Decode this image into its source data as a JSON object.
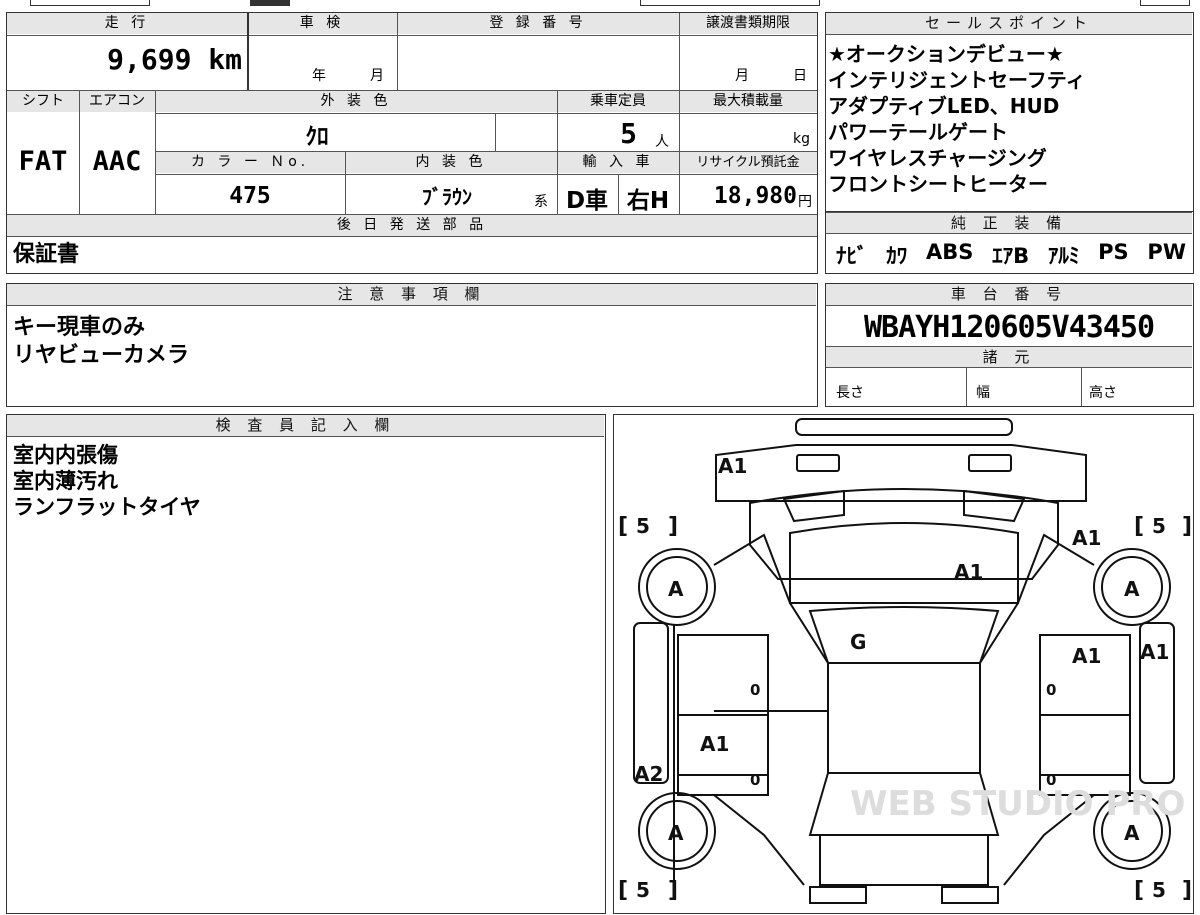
{
  "top_header": {
    "mileage_label": "走 行",
    "shaken_label": "車 検",
    "registration_label": "登 録 番 号",
    "transfer_deadline_label": "譲渡書類期限",
    "mileage_value": "9,699 km",
    "shaken_year": "年",
    "shaken_month": "月",
    "deadline_month": "月",
    "deadline_day": "日"
  },
  "row2": {
    "shift_label": "シフト",
    "aircon_label": "エアコン",
    "exterior_label": "外 装 色",
    "capacity_label": "乗車定員",
    "max_load_label": "最大積載量",
    "shift_value": "FAT",
    "aircon_value": "AAC",
    "exterior_value": "ｸﾛ",
    "capacity_value": "5",
    "capacity_unit": "人",
    "load_unit": "kg"
  },
  "row3": {
    "color_no_label": "カ ラ ー Ｎo.",
    "interior_label": "内 装 色",
    "import_label": "輸 入 車",
    "recycle_label": "リサイクル預託金",
    "color_no_value": "475",
    "interior_value": "ﾌﾞﾗｳﾝ",
    "interior_suffix": "系",
    "import_value": "D車",
    "handle_value": "右H",
    "recycle_value": "18,980",
    "recycle_unit": "円"
  },
  "later_parts": {
    "label": "後 日 発 送 部 品",
    "value": "保証書"
  },
  "sales_points": {
    "label": "セールスポイント",
    "items": [
      "★オークションデビュー★",
      "インテリジェントセーフティ",
      "アダプティブLED、HUD",
      "パワーテールゲート",
      "ワイヤレスチャージング",
      "フロントシートヒーター"
    ]
  },
  "genuine_equipment": {
    "label": "純 正 装 備",
    "items": [
      "ﾅﾋﾞ",
      "ｶﾜ",
      "ABS",
      "ｴｱB",
      "ｱﾙﾐ",
      "PS",
      "PW"
    ]
  },
  "notes": {
    "label": "注 意 事 項 欄",
    "lines": [
      "キー現車のみ",
      "リヤビューカメラ"
    ]
  },
  "chassis": {
    "label": "車 台 番 号",
    "value": "WBAYH120605V43450",
    "specs_label": "諸 元",
    "length_label": "長さ",
    "width_label": "幅",
    "height_label": "高さ"
  },
  "inspector": {
    "label": "検 査 員 記 入 欄",
    "lines": [
      "室内内張傷",
      "室内薄汚れ",
      "ランフラットタイヤ"
    ]
  },
  "diagram": {
    "marks": {
      "front_bumper": "A1",
      "windshield": "A1",
      "roof": "G",
      "right_front_fender": "A1",
      "right_front_door": "A1",
      "right_sill": "A1",
      "left_rear_door": "A1",
      "left_sill": "A2",
      "tire_lf": "A",
      "tire_rf": "A",
      "tire_lr": "A",
      "tire_rr": "A",
      "tread_lf": "5",
      "tread_rf": "5",
      "tread_lr": "5",
      "tread_rr": "5",
      "zero": "0"
    },
    "watermark": "WEB STUDIO PRO"
  }
}
